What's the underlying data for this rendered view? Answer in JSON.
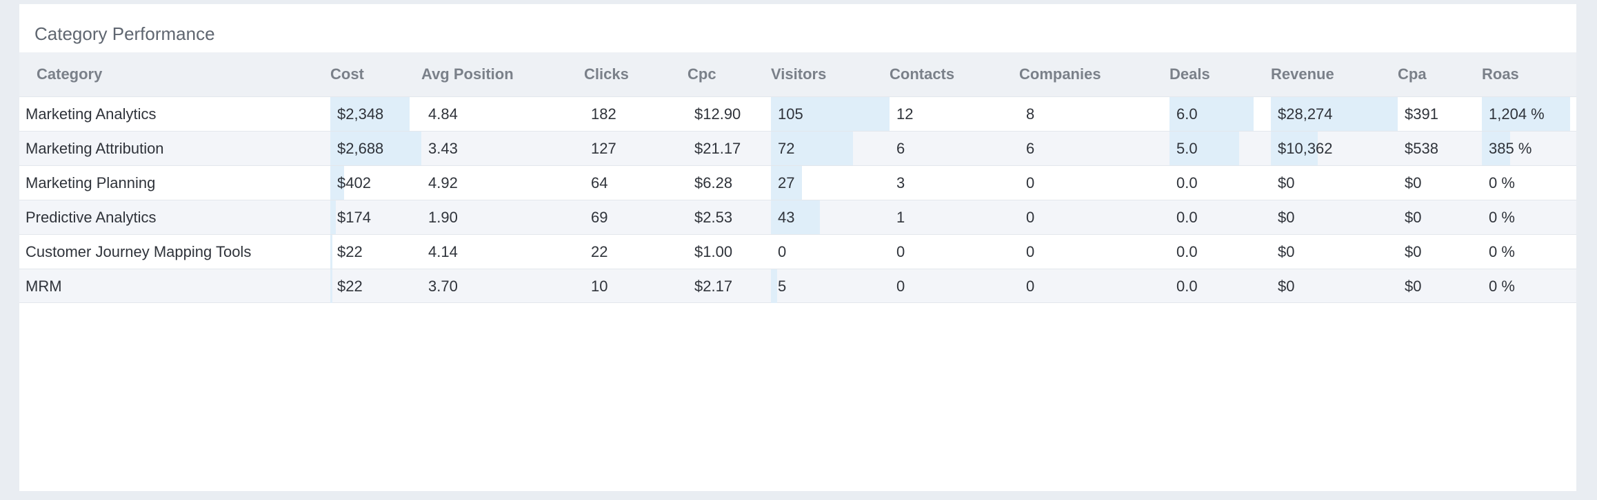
{
  "widget": {
    "title": "Category Performance"
  },
  "columns": [
    {
      "key": "category",
      "label": "Category"
    },
    {
      "key": "cost",
      "label": "Cost"
    },
    {
      "key": "avg_position",
      "label": "Avg Position"
    },
    {
      "key": "clicks",
      "label": "Clicks"
    },
    {
      "key": "cpc",
      "label": "Cpc"
    },
    {
      "key": "visitors",
      "label": "Visitors"
    },
    {
      "key": "contacts",
      "label": "Contacts"
    },
    {
      "key": "companies",
      "label": "Companies"
    },
    {
      "key": "deals",
      "label": "Deals"
    },
    {
      "key": "revenue",
      "label": "Revenue"
    },
    {
      "key": "cpa",
      "label": "Cpa"
    },
    {
      "key": "roas",
      "label": "Roas"
    }
  ],
  "rows": [
    {
      "category": "Marketing Analytics",
      "cost": "$2,348",
      "avg_position": "4.84",
      "clicks": "182",
      "cpc": "$12.90",
      "visitors": "105",
      "contacts": "12",
      "companies": "8",
      "deals": "6.0",
      "revenue": "$28,274",
      "cpa": "$391",
      "roas": "1,204 %"
    },
    {
      "category": "Marketing Attribution",
      "cost": "$2,688",
      "avg_position": "3.43",
      "clicks": "127",
      "cpc": "$21.17",
      "visitors": "72",
      "contacts": "6",
      "companies": "6",
      "deals": "5.0",
      "revenue": "$10,362",
      "cpa": "$538",
      "roas": "385 %"
    },
    {
      "category": "Marketing Planning",
      "cost": "$402",
      "avg_position": "4.92",
      "clicks": "64",
      "cpc": "$6.28",
      "visitors": "27",
      "contacts": "3",
      "companies": "0",
      "deals": "0.0",
      "revenue": "$0",
      "cpa": "$0",
      "roas": "0 %"
    },
    {
      "category": "Predictive Analytics",
      "cost": "$174",
      "avg_position": "1.90",
      "clicks": "69",
      "cpc": "$2.53",
      "visitors": "43",
      "contacts": "1",
      "companies": "0",
      "deals": "0.0",
      "revenue": "$0",
      "cpa": "$0",
      "roas": "0 %"
    },
    {
      "category": "Customer Journey Mapping Tools",
      "cost": "$22",
      "avg_position": "4.14",
      "clicks": "22",
      "cpc": "$1.00",
      "visitors": "0",
      "contacts": "0",
      "companies": "0",
      "deals": "0.0",
      "revenue": "$0",
      "cpa": "$0",
      "roas": "0 %"
    },
    {
      "category": "MRM",
      "cost": "$22",
      "avg_position": "3.70",
      "clicks": "10",
      "cpc": "$2.17",
      "visitors": "5",
      "contacts": "0",
      "companies": "0",
      "deals": "0.0",
      "revenue": "$0",
      "cpa": "$0",
      "roas": "0 %"
    }
  ],
  "bar_levels": {
    "cost": [
      0.87,
      1.0,
      0.15,
      0.06,
      0.008,
      0.008
    ],
    "visitors": [
      1.0,
      0.69,
      0.26,
      0.41,
      0.0,
      0.05
    ],
    "deals": [
      1.0,
      0.83,
      0,
      0,
      0,
      0
    ],
    "revenue": [
      1.0,
      0.37,
      0,
      0,
      0,
      0
    ],
    "roas": [
      1.0,
      0.32,
      0,
      0,
      0,
      0
    ]
  },
  "colors": {
    "bar": "#dfeef9",
    "header_bg": "#eef1f5",
    "row_alt_bg": "#f3f5f9"
  }
}
